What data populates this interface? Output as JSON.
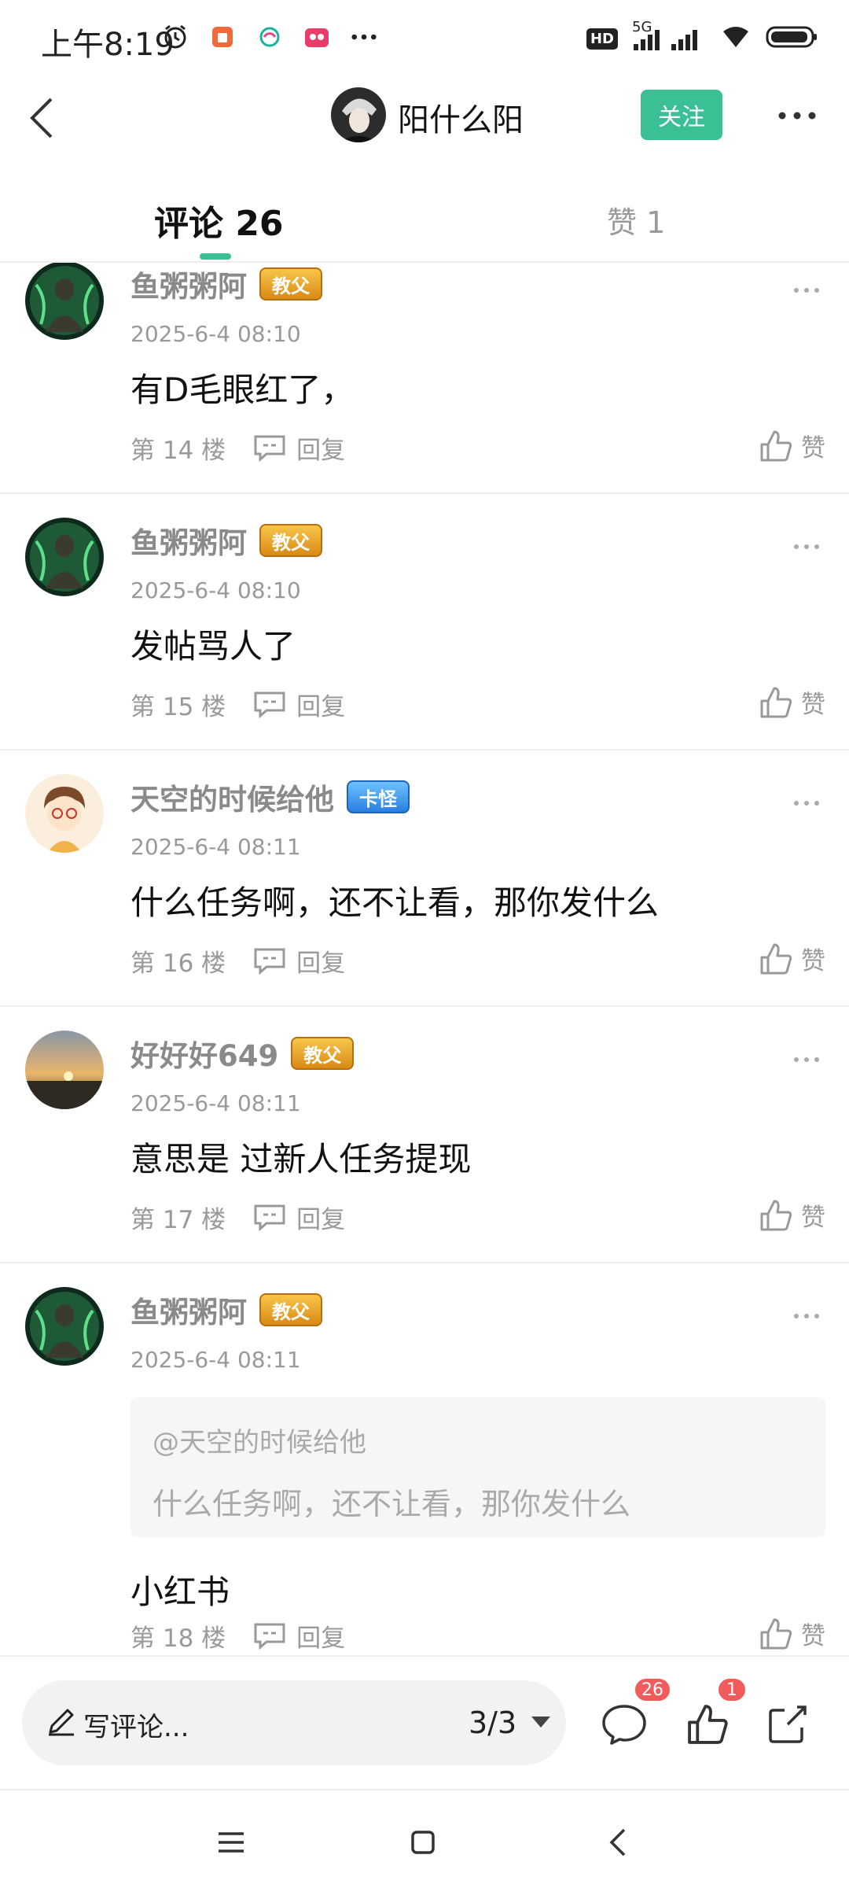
{
  "status_bar": {
    "time": "上午8:19",
    "network": "5G",
    "hd": "HD"
  },
  "header": {
    "username": "阳什么阳",
    "follow_label": "关注"
  },
  "tabs": {
    "comments_label": "评论 26",
    "likes_label": "赞 1"
  },
  "comments": [
    {
      "name": "鱼粥粥阿",
      "badge": "教父",
      "time": "2025-6-4 08:10",
      "text": "有D毛眼红了，",
      "floor": "第 14 楼",
      "reply": "回复",
      "like": "赞"
    },
    {
      "name": "鱼粥粥阿",
      "badge": "教父",
      "time": "2025-6-4 08:10",
      "text": "发帖骂人了",
      "floor": "第 15 楼",
      "reply": "回复",
      "like": "赞"
    },
    {
      "name": "天空的时候给他",
      "badge": "卡怪",
      "time": "2025-6-4 08:11",
      "text": "什么任务啊，还不让看，那你发什么",
      "floor": "第 16 楼",
      "reply": "回复",
      "like": "赞"
    },
    {
      "name": "好好好649",
      "badge": "教父",
      "time": "2025-6-4 08:11",
      "text": "意思是 过新人任务提现",
      "floor": "第 17 楼",
      "reply": "回复",
      "like": "赞"
    },
    {
      "name": "鱼粥粥阿",
      "badge": "教父",
      "time": "2025-6-4 08:11",
      "quote_user": "@天空的时候给他",
      "quote_text": "什么任务啊，还不让看，那你发什么",
      "text": "小红书",
      "floor": "第 18 楼",
      "reply": "回复",
      "like": "赞"
    }
  ],
  "bottom_bar": {
    "write_placeholder": "写评论...",
    "page": "3/3",
    "comment_count": "26",
    "like_count": "1"
  },
  "colors": {
    "accent": "#3bbf94",
    "badge_red": "#f25b5b",
    "muted_text": "#999999"
  }
}
